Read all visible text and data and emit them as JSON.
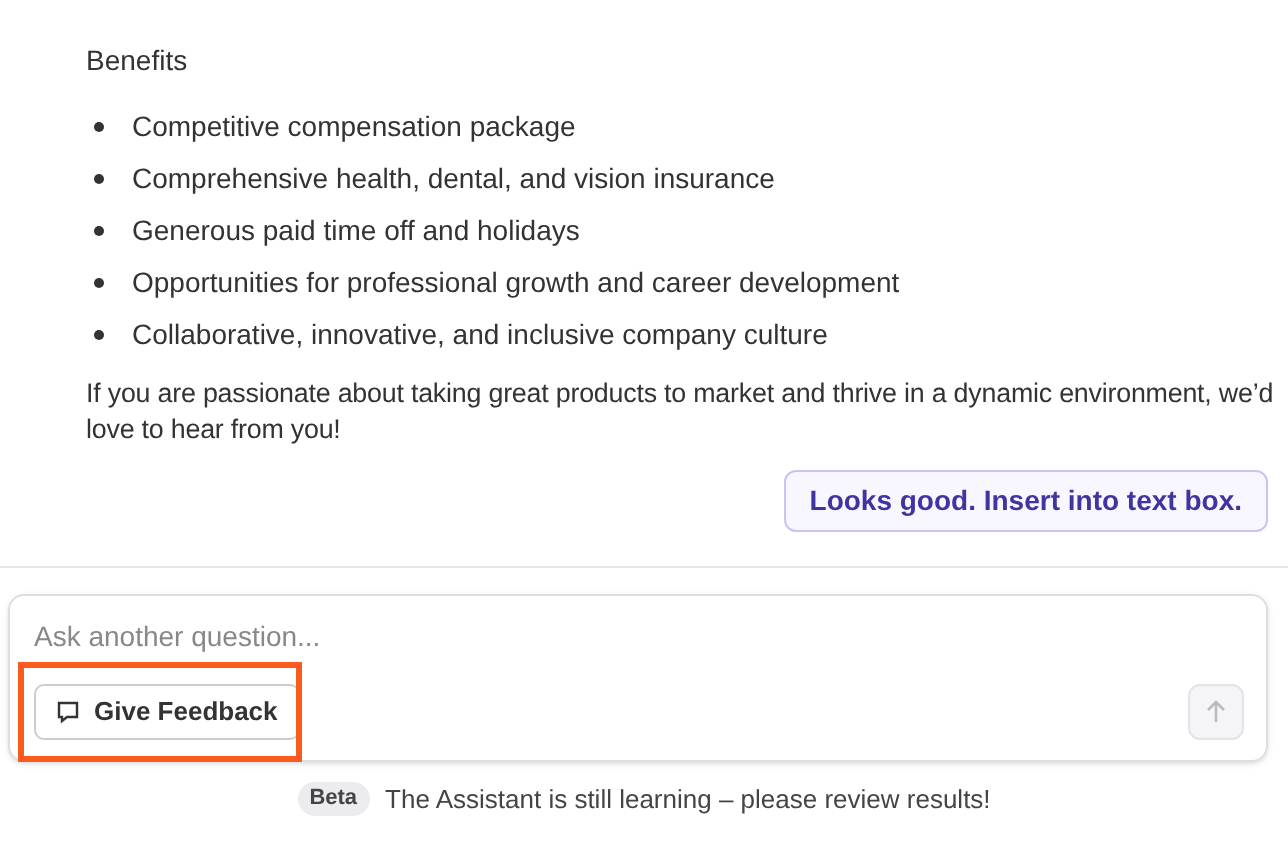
{
  "message": {
    "heading": "Benefits",
    "bullets": [
      "Competitive compensation package",
      "Comprehensive health, dental, and vision insurance",
      "Generous paid time off and holidays",
      "Opportunities for professional growth and career development",
      "Collaborative, innovative, and inclusive company culture"
    ],
    "closing": "If you are passionate about taking great products to market and thrive in a dynamic environment, we’d love to hear from you!",
    "insert_button": "Looks good. Insert into text box."
  },
  "composer": {
    "placeholder": "Ask another question...",
    "feedback_button": {
      "label": "Give Feedback",
      "highlighted": true
    },
    "send_disabled": true
  },
  "footer": {
    "badge": "Beta",
    "note": "The Assistant is still learning – please review results!"
  }
}
